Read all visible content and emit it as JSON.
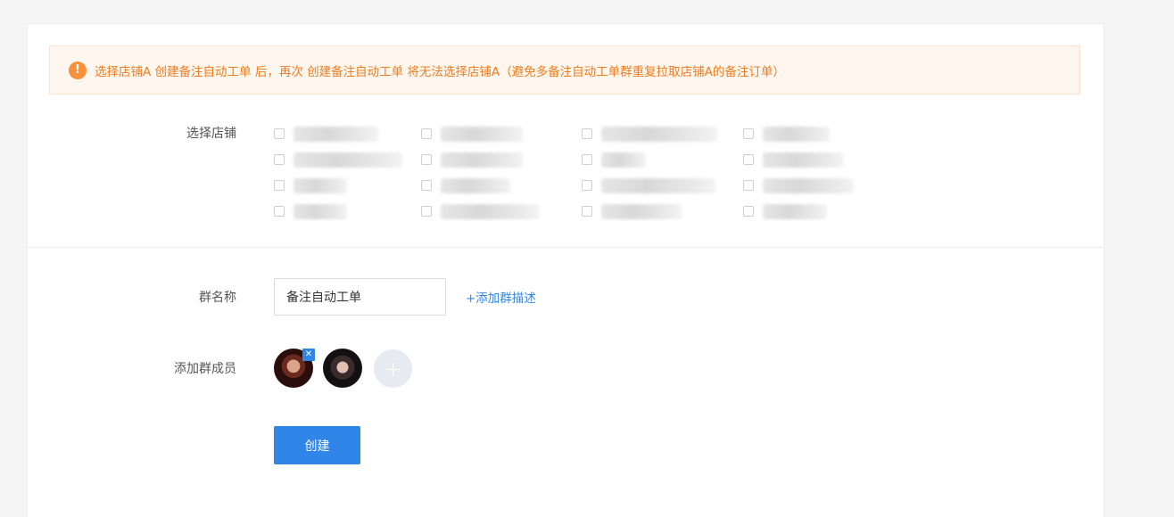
{
  "alert": {
    "icon": "exclamation-icon",
    "text": "选择店铺A 创建备注自动工单 后，再次 创建备注自动工单 将无法选择店铺A（避免多备注自动工单群重复拉取店铺A的备注订单）"
  },
  "form": {
    "store_label": "选择店铺",
    "group_name_label": "群名称",
    "group_name_value": "备注自动工单",
    "add_desc_link": "+添加群描述",
    "members_label": "添加群成员",
    "remove_member_icon": "✕",
    "add_member_icon": "+",
    "create_button": "创建"
  },
  "colors": {
    "accent": "#2f86e8",
    "warning": "#f07c1c",
    "warning_bg": "#fff7ef"
  }
}
